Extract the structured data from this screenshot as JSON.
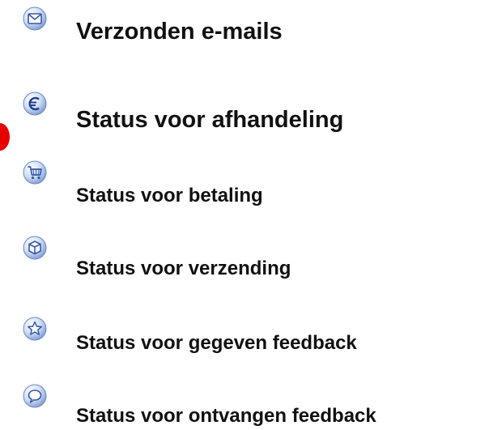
{
  "items": [
    {
      "label": "Verzonden e-mails",
      "icon": "envelope-icon"
    },
    {
      "label": "Status voor afhandeling",
      "icon": "euro-icon"
    },
    {
      "label": "Status voor betaling",
      "icon": "shopping-cart-icon"
    },
    {
      "label": "Status voor verzending",
      "icon": "package-box-icon"
    },
    {
      "label": "Status voor gegeven feedback",
      "icon": "star-icon"
    },
    {
      "label": "Status voor ontvangen feedback",
      "icon": "speech-bubble-icon"
    }
  ],
  "colors": {
    "icon_fill": "#c7d6f0",
    "icon_stroke": "#3459a8",
    "text": "#111111",
    "marker": "#e60000"
  }
}
